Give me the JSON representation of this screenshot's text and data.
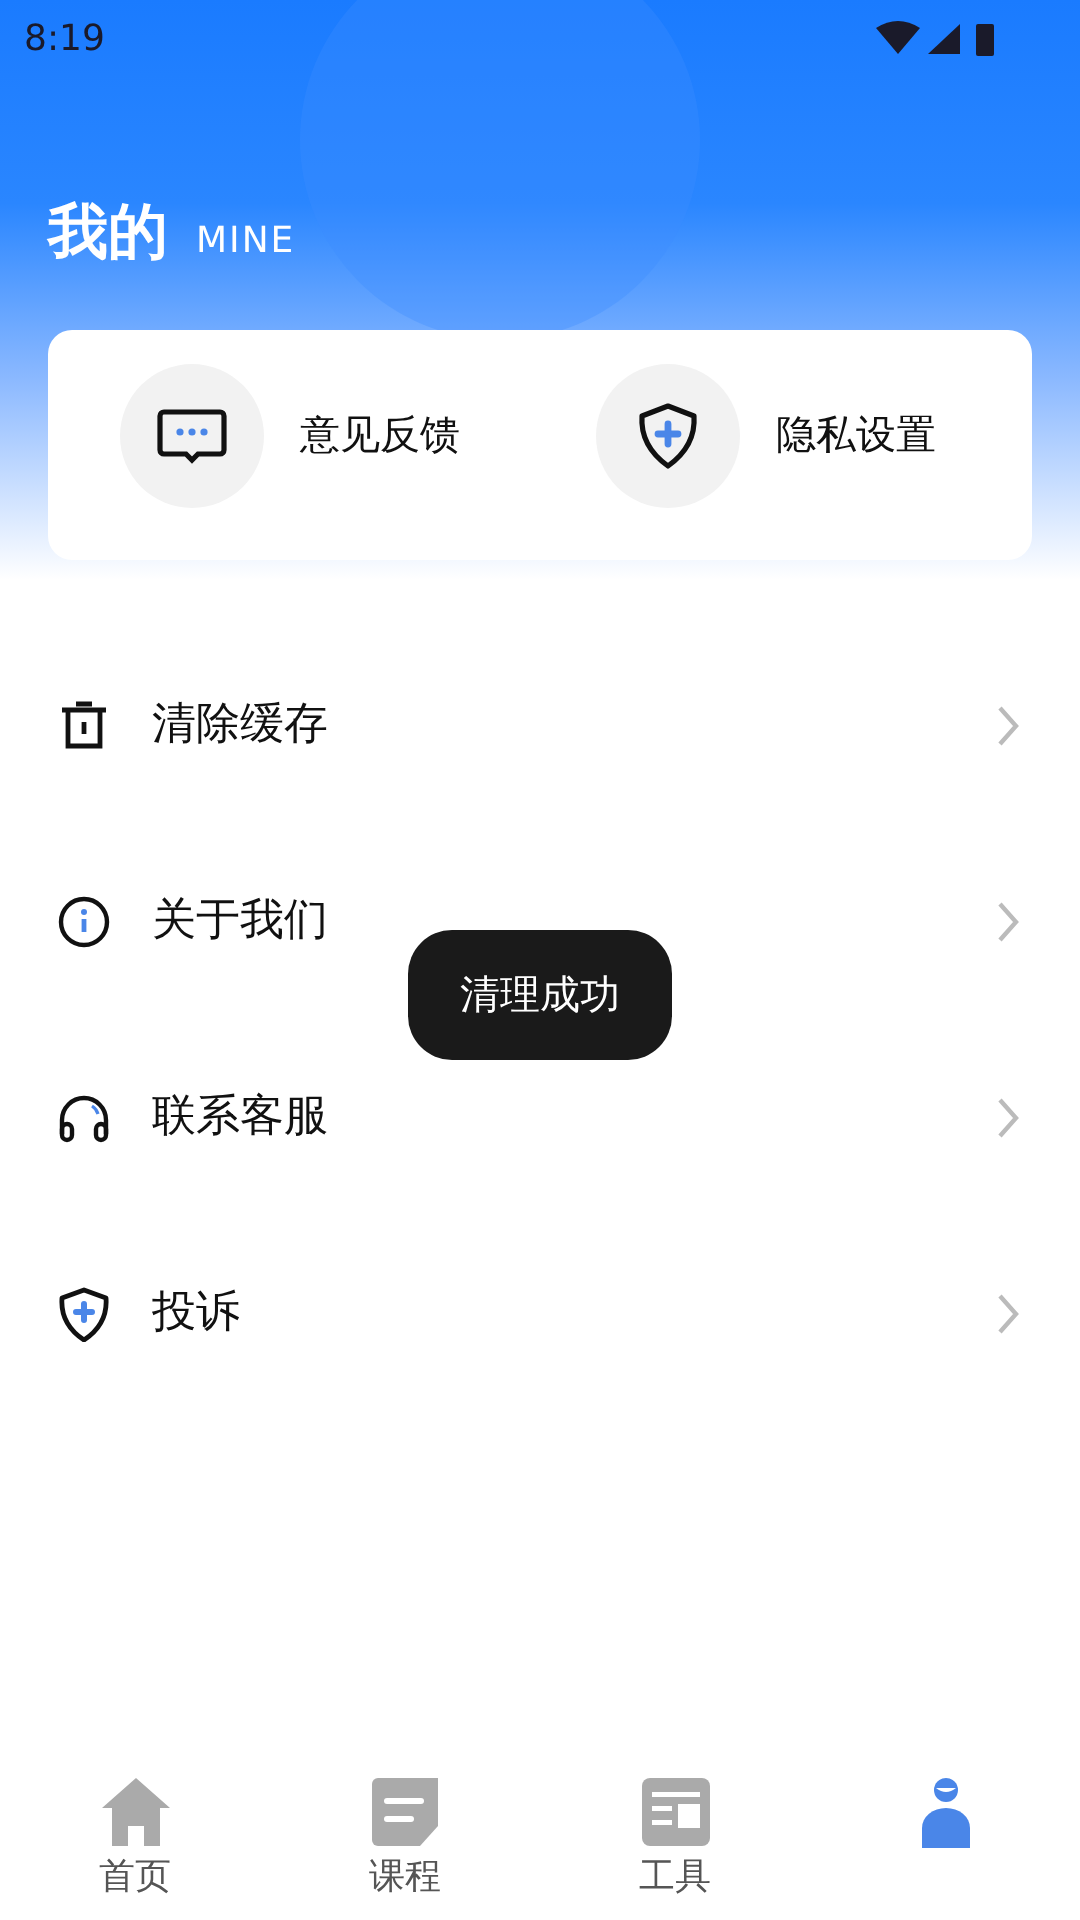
{
  "status_bar": {
    "time": "8:19"
  },
  "header": {
    "title": "我的",
    "subtitle": "MINE"
  },
  "quick_actions": [
    {
      "label": "意见反馈"
    },
    {
      "label": "隐私设置"
    }
  ],
  "menu": [
    {
      "label": "清除缓存"
    },
    {
      "label": "关于我们"
    },
    {
      "label": "联系客服"
    },
    {
      "label": "投诉"
    }
  ],
  "toast": {
    "text": "清理成功"
  },
  "tabs": [
    {
      "label": "首页",
      "selected": false
    },
    {
      "label": "课程",
      "selected": false
    },
    {
      "label": "工具",
      "selected": false
    },
    {
      "selected": true
    }
  ]
}
